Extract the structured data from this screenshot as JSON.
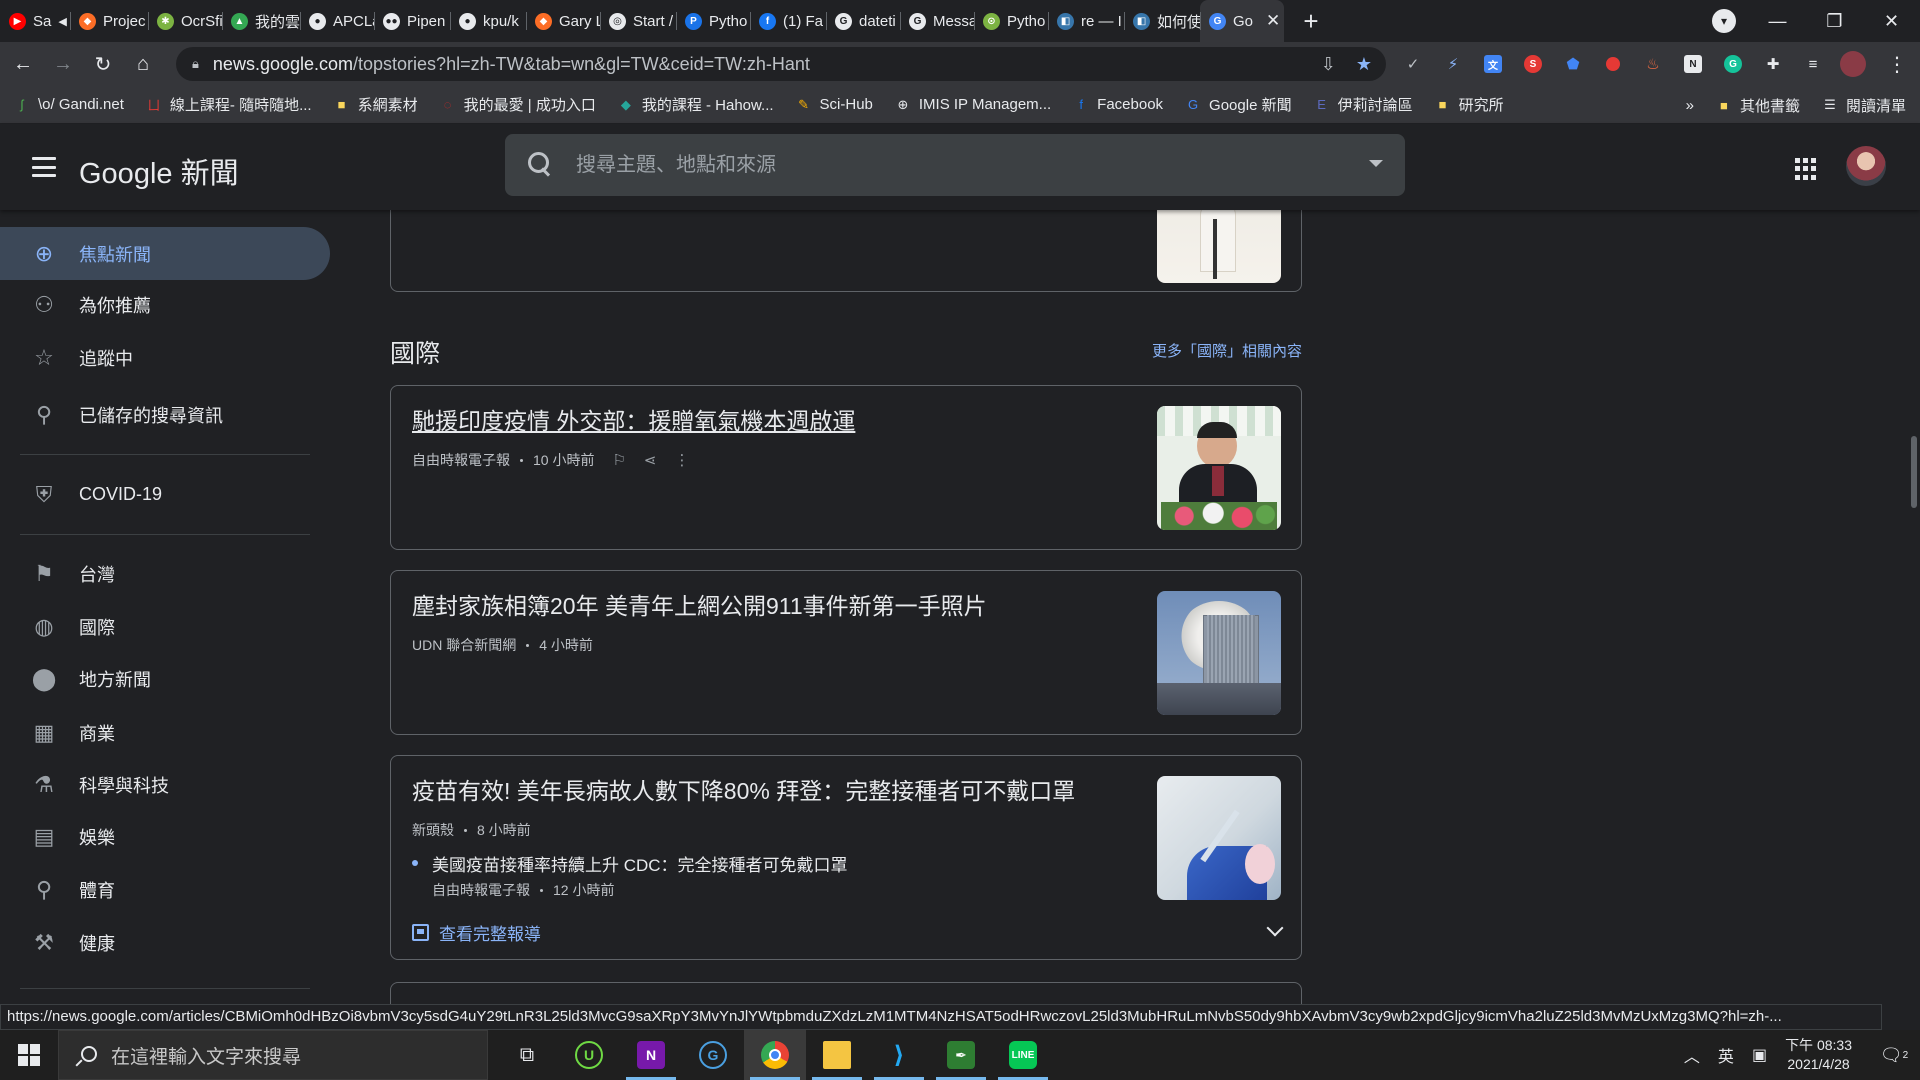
{
  "browser": {
    "tabs": [
      {
        "title": "Sa",
        "icon": "youtube-icon",
        "color": "#ff0000",
        "glyph": "▶",
        "audio": true
      },
      {
        "title": "Projec",
        "icon": "gitlab-icon",
        "color": "#fc6d26",
        "glyph": "◆"
      },
      {
        "title": "OcrSfi",
        "icon": "app-icon",
        "color": "#7cb342",
        "glyph": "✱"
      },
      {
        "title": "我的雲",
        "icon": "google-drive-icon",
        "color": "#34a853",
        "glyph": "▲"
      },
      {
        "title": "APCLa",
        "icon": "github-icon",
        "color": "#e8eaed",
        "glyph": "●"
      },
      {
        "title": "Pipen",
        "icon": "medium-icon",
        "color": "#e8eaed",
        "glyph": "●●"
      },
      {
        "title": "kpu/k",
        "icon": "github-icon",
        "color": "#e8eaed",
        "glyph": "●"
      },
      {
        "title": "Gary L",
        "icon": "gitlab-icon",
        "color": "#fc6d26",
        "glyph": "◆"
      },
      {
        "title": "Start /",
        "icon": "app-icon",
        "color": "#e8eaed",
        "glyph": "◎"
      },
      {
        "title": "Pytho",
        "icon": "app-icon",
        "color": "#1a73e8",
        "glyph": "P"
      },
      {
        "title": "(1) Fa",
        "icon": "facebook-icon",
        "color": "#1877f2",
        "glyph": "f"
      },
      {
        "title": "dateti",
        "icon": "google-icon",
        "color": "#e8eaed",
        "glyph": "G"
      },
      {
        "title": "Messa",
        "icon": "google-icon",
        "color": "#e8eaed",
        "glyph": "G"
      },
      {
        "title": "Pytho",
        "icon": "app-icon",
        "color": "#7cb342",
        "glyph": "⊙"
      },
      {
        "title": "re — I",
        "icon": "python-icon",
        "color": "#3776ab",
        "glyph": "◧"
      },
      {
        "title": "如何使",
        "icon": "python-icon",
        "color": "#3776ab",
        "glyph": "◧"
      },
      {
        "title": "Go",
        "icon": "google-news-icon",
        "color": "#4285f4",
        "glyph": "G",
        "active": true
      }
    ],
    "url_host": "news.google.com",
    "url_path": "/topstories?hl=zh-TW&tab=wn&gl=TW&ceid=TW:zh-Hant",
    "bookmarks": [
      {
        "label": "\\o/ Gandi.net",
        "icon": "gandi-icon",
        "color": "#4caf50",
        "glyph": "ʃ"
      },
      {
        "label": "線上課程- 隨時隨地...",
        "icon": "course-icon",
        "color": "#e53935",
        "glyph": "ㄩ"
      },
      {
        "label": "系網素材",
        "icon": "folder-icon",
        "color": "#f9d65c",
        "glyph": "■"
      },
      {
        "label": "我的最愛 | 成功入口",
        "icon": "ncku-icon",
        "color": "#c62828",
        "glyph": "◌"
      },
      {
        "label": "我的課程 - Hahow...",
        "icon": "hahow-icon",
        "color": "#26a69a",
        "glyph": "◆"
      },
      {
        "label": "Sci-Hub",
        "icon": "scihub-icon",
        "color": "#ffb300",
        "glyph": "✎"
      },
      {
        "label": "IMIS IP Managem...",
        "icon": "globe-icon",
        "color": "#e8eaed",
        "glyph": "⊕"
      },
      {
        "label": "Facebook",
        "icon": "facebook-icon",
        "color": "#1877f2",
        "glyph": "f"
      },
      {
        "label": "Google 新聞",
        "icon": "google-news-icon",
        "color": "#4285f4",
        "glyph": "G"
      },
      {
        "label": "伊莉討論區",
        "icon": "forum-icon",
        "color": "#5c6bc0",
        "glyph": "E"
      },
      {
        "label": "研究所",
        "icon": "folder-icon",
        "color": "#f9d65c",
        "glyph": "■"
      }
    ],
    "bookmarks_overflow": "»",
    "other_bookmarks": "其他書籤",
    "reading_list": "閱讀清單"
  },
  "app": {
    "logo": "Google 新聞",
    "search_placeholder": "搜尋主題、地點和來源"
  },
  "sidebar": {
    "items": [
      {
        "label": "焦點新聞",
        "icon": "globe-icon",
        "glyph": "⊕",
        "active": true
      },
      {
        "label": "為你推薦",
        "icon": "person-icon",
        "glyph": "⚇"
      },
      {
        "label": "追蹤中",
        "icon": "star-icon",
        "glyph": "☆"
      },
      {
        "label": "已儲存的搜尋資訊",
        "icon": "search-icon",
        "glyph": "⚲"
      },
      {
        "label": "COVID-19",
        "icon": "health-shield-icon",
        "glyph": "⛨"
      },
      {
        "label": "台灣",
        "icon": "flag-icon",
        "glyph": "⚑"
      },
      {
        "label": "國際",
        "icon": "world-icon",
        "glyph": "◍"
      },
      {
        "label": "地方新聞",
        "icon": "location-pin-icon",
        "glyph": "⬤"
      },
      {
        "label": "商業",
        "icon": "building-icon",
        "glyph": "▦"
      },
      {
        "label": "科學與科技",
        "icon": "flask-icon",
        "glyph": "⚗"
      },
      {
        "label": "娛樂",
        "icon": "film-icon",
        "glyph": "▤"
      },
      {
        "label": "體育",
        "icon": "bike-icon",
        "glyph": "⚲"
      },
      {
        "label": "健康",
        "icon": "tools-icon",
        "glyph": "⚒"
      }
    ]
  },
  "main": {
    "section_title": "國際",
    "section_more": "更多「國際」相關內容",
    "articles": [
      {
        "headline": "馳援印度疫情 外交部：援贈氧氣機本週啟運",
        "source": "自由時報電子報",
        "time": "10 小時前"
      },
      {
        "headline": "塵封家族相簿20年 美青年上網公開911事件新第一手照片",
        "source": "UDN 聯合新聞網",
        "time": "4 小時前"
      },
      {
        "headline": "疫苗有效! 美年長病故人數下降80% 拜登：完整接種者可不戴口罩",
        "source": "新頭殼",
        "time": "8 小時前",
        "related_headline": "美國疫苗接種率持續上升 CDC：完全接種者可免戴口罩",
        "related_source": "自由時報電子報",
        "related_time": "12 小時前",
        "full_coverage": "查看完整報導"
      }
    ]
  },
  "status_url": "https://news.google.com/articles/CBMiOmh0dHBzOi8vbmV3cy5sdG4uY29tLnR3L25ld3MvcG9saXRpY3MvYnJlYWtpbmduZXdzLzM1MTM4NzHSAT5odHRwczovL25ld3MubHRuLmNvbS50dy9hbXAvbmV3cy9wb2xpdGljcy9icmVha2luZ25ld3MvMzUxMzg3MQ?hl=zh-...",
  "taskbar": {
    "search_placeholder": "在這裡輸入文字來搜尋",
    "ime_lang": "英",
    "time": "下午 08:33",
    "date": "2021/4/28",
    "notification_count": "2"
  }
}
